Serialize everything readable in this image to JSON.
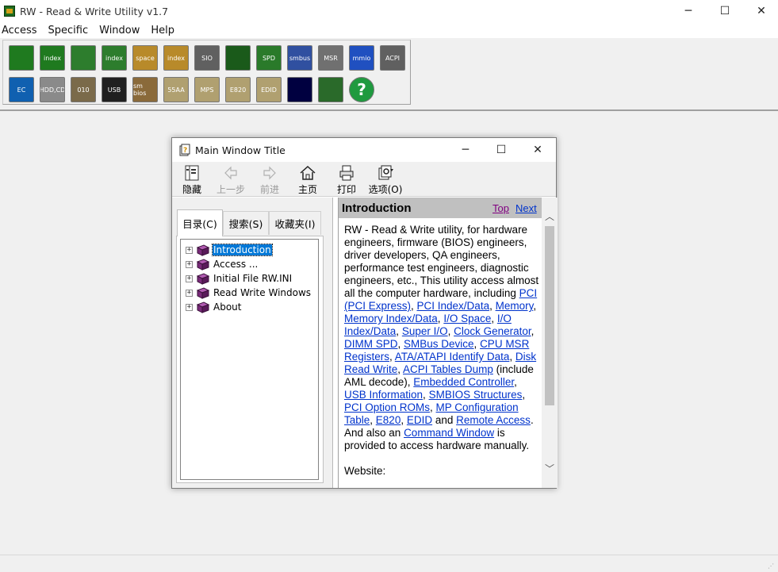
{
  "app": {
    "title": "RW - Read & Write Utility v1.7",
    "controls": {
      "minimize": "─",
      "maximize": "☐",
      "close": "✕"
    }
  },
  "menu": [
    "Access",
    "Specific",
    "Window",
    "Help"
  ],
  "toolbar": {
    "row1": [
      {
        "icon": "pci-card-icon",
        "label": "",
        "color": "#1f7a1f"
      },
      {
        "icon": "pci-index-icon",
        "label": "index",
        "color": "#1f7a1f"
      },
      {
        "icon": "memory-icon",
        "label": "",
        "color": "#2d7d2d"
      },
      {
        "icon": "memory-index-icon",
        "label": "index",
        "color": "#2d7d2d"
      },
      {
        "icon": "io-space-icon",
        "label": "space",
        "color": "#b88a2a"
      },
      {
        "icon": "io-index-icon",
        "label": "index",
        "color": "#b88a2a"
      },
      {
        "icon": "super-io-icon",
        "label": "SIO",
        "color": "#606060"
      },
      {
        "icon": "clock-generator-icon",
        "label": "",
        "color": "#1a5a1a"
      },
      {
        "icon": "dimm-spd-icon",
        "label": "SPD",
        "color": "#2a7a2a"
      },
      {
        "icon": "smbus-icon",
        "label": "smbus",
        "color": "#3050a0"
      },
      {
        "icon": "msr-icon",
        "label": "MSR",
        "color": "#707070"
      },
      {
        "icon": "mmio-icon",
        "label": "mmio",
        "color": "#2050c0"
      },
      {
        "icon": "acpi-icon",
        "label": "ACPI",
        "color": "#606060"
      }
    ],
    "row2": [
      {
        "icon": "embedded-controller-icon",
        "label": "EC",
        "color": "#1060b0"
      },
      {
        "icon": "disk-icon",
        "label": "HDD,CD",
        "color": "#8a8a8a"
      },
      {
        "icon": "ata-identify-icon",
        "label": "010",
        "color": "#7a6a4a"
      },
      {
        "icon": "usb-icon",
        "label": "USB",
        "color": "#202020"
      },
      {
        "icon": "smbios-icon",
        "label": "sm bios",
        "color": "#8a6a3a"
      },
      {
        "icon": "option-rom-icon",
        "label": "55AA",
        "color": "#b0a070"
      },
      {
        "icon": "mp-table-icon",
        "label": "MPS",
        "color": "#b0a070"
      },
      {
        "icon": "e820-icon",
        "label": "E820",
        "color": "#b0a070"
      },
      {
        "icon": "edid-icon",
        "label": "EDID",
        "color": "#b0a070"
      },
      {
        "icon": "command-window-icon",
        "label": "",
        "color": "#000040"
      },
      {
        "icon": "remote-access-icon",
        "label": "",
        "color": "#2a6a2a"
      },
      {
        "icon": "help-icon",
        "label": "?",
        "color": "#1f9a3f"
      }
    ]
  },
  "help_window": {
    "title": "Main Window Title",
    "controls": {
      "minimize": "─",
      "maximize": "☐",
      "close": "✕"
    },
    "tools": [
      {
        "name": "hide",
        "label": "隐藏",
        "enabled": true
      },
      {
        "name": "back",
        "label": "上一步",
        "enabled": false
      },
      {
        "name": "forward",
        "label": "前进",
        "enabled": false
      },
      {
        "name": "home",
        "label": "主页",
        "enabled": true
      },
      {
        "name": "print",
        "label": "打印",
        "enabled": true
      },
      {
        "name": "options",
        "label": "选项(O)",
        "enabled": true
      }
    ],
    "tabs": [
      "目录(C)",
      "搜索(S)",
      "收藏夹(I)"
    ],
    "tree": [
      {
        "label": "Introduction",
        "selected": true
      },
      {
        "label": "Access ...",
        "selected": false
      },
      {
        "label": "Initial File RW.INI",
        "selected": false
      },
      {
        "label": "Read Write Windows",
        "selected": false
      },
      {
        "label": "About",
        "selected": false
      }
    ],
    "topic": {
      "title": "Introduction",
      "top_link": "Top",
      "next_link": "Next",
      "link_colors": {
        "visited": "#800080",
        "link": "#0033cc"
      },
      "website_label": "Website:"
    }
  }
}
